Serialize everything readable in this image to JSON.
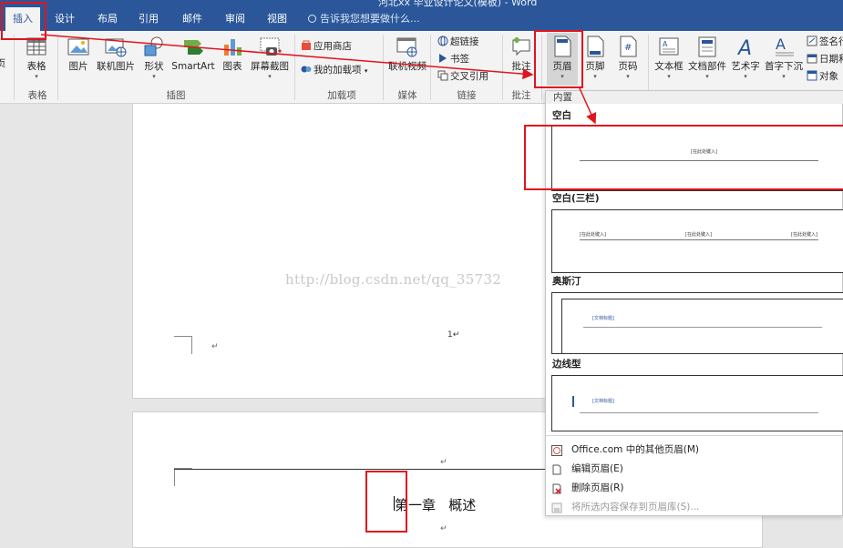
{
  "window": {
    "title_fragment": "河北xx 毕业设计论文(模板) - Word"
  },
  "tabs": [
    "插入",
    "设计",
    "布局",
    "引用",
    "邮件",
    "审阅",
    "视图"
  ],
  "tell_me": "告诉我您想要做什么...",
  "ribbon": {
    "cut_left": "页",
    "table": "表格",
    "picture": "图片",
    "online_picture": "联机图片",
    "shapes": "形状",
    "smartart": "SmartArt",
    "chart": "图表",
    "screenshot": "屏幕截图",
    "store": "应用商店",
    "my_addins": "我的加载项",
    "online_video": "联机视频",
    "hyperlink": "超链接",
    "bookmark": "书签",
    "cross_ref": "交叉引用",
    "comment": "批注",
    "header": "页眉",
    "footer": "页脚",
    "page_number": "页码",
    "textbox": "文本框",
    "quick_parts": "文档部件",
    "wordart": "艺术字",
    "dropcap": "首字下沉",
    "signature": "签名行",
    "datetime": "日期和",
    "object": "对象",
    "groups": {
      "tables": "表格",
      "illustrations": "插图",
      "addins": "加载项",
      "media": "媒体",
      "links": "链接",
      "comments": "批注"
    }
  },
  "document": {
    "page_number_mark": "1↵",
    "para_mark": "↵",
    "chapter_title": "第一章   概述",
    "watermark": "http://blog.csdn.net/qq_35732"
  },
  "dropdown": {
    "section": "内置",
    "templates": [
      {
        "name": "空白",
        "placeholders": [
          "[在此处键入]"
        ]
      },
      {
        "name": "空白(三栏)",
        "placeholders": [
          "[在此处键入]",
          "[在此处键入]",
          "[在此处键入]"
        ]
      },
      {
        "name": "奥斯汀",
        "placeholders": [
          "[文档标题]"
        ]
      },
      {
        "name": "边线型",
        "placeholders": [
          "[文档标题]"
        ]
      }
    ],
    "menu": [
      "Office.com 中的其他页眉(M)",
      "编辑页眉(E)",
      "删除页眉(R)",
      "将所选内容保存到页眉库(S)..."
    ]
  },
  "colors": {
    "ribbon_blue": "#2b579a",
    "annotation_red": "#e0141e"
  }
}
